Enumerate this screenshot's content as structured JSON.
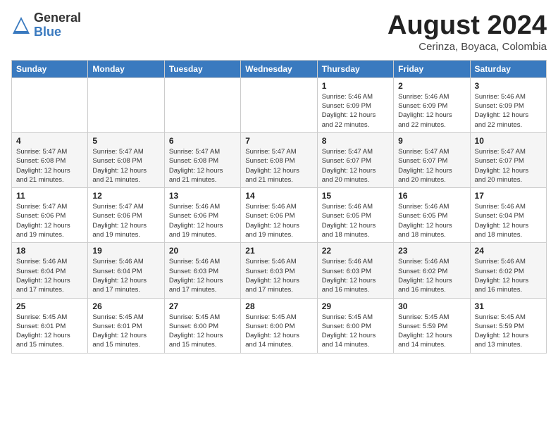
{
  "header": {
    "logo_general": "General",
    "logo_blue": "Blue",
    "month_title": "August 2024",
    "subtitle": "Cerinza, Boyaca, Colombia"
  },
  "weekdays": [
    "Sunday",
    "Monday",
    "Tuesday",
    "Wednesday",
    "Thursday",
    "Friday",
    "Saturday"
  ],
  "weeks": [
    [
      {
        "day": "",
        "content": ""
      },
      {
        "day": "",
        "content": ""
      },
      {
        "day": "",
        "content": ""
      },
      {
        "day": "",
        "content": ""
      },
      {
        "day": "1",
        "content": "Sunrise: 5:46 AM\nSunset: 6:09 PM\nDaylight: 12 hours\nand 22 minutes."
      },
      {
        "day": "2",
        "content": "Sunrise: 5:46 AM\nSunset: 6:09 PM\nDaylight: 12 hours\nand 22 minutes."
      },
      {
        "day": "3",
        "content": "Sunrise: 5:46 AM\nSunset: 6:09 PM\nDaylight: 12 hours\nand 22 minutes."
      }
    ],
    [
      {
        "day": "4",
        "content": "Sunrise: 5:47 AM\nSunset: 6:08 PM\nDaylight: 12 hours\nand 21 minutes."
      },
      {
        "day": "5",
        "content": "Sunrise: 5:47 AM\nSunset: 6:08 PM\nDaylight: 12 hours\nand 21 minutes."
      },
      {
        "day": "6",
        "content": "Sunrise: 5:47 AM\nSunset: 6:08 PM\nDaylight: 12 hours\nand 21 minutes."
      },
      {
        "day": "7",
        "content": "Sunrise: 5:47 AM\nSunset: 6:08 PM\nDaylight: 12 hours\nand 21 minutes."
      },
      {
        "day": "8",
        "content": "Sunrise: 5:47 AM\nSunset: 6:07 PM\nDaylight: 12 hours\nand 20 minutes."
      },
      {
        "day": "9",
        "content": "Sunrise: 5:47 AM\nSunset: 6:07 PM\nDaylight: 12 hours\nand 20 minutes."
      },
      {
        "day": "10",
        "content": "Sunrise: 5:47 AM\nSunset: 6:07 PM\nDaylight: 12 hours\nand 20 minutes."
      }
    ],
    [
      {
        "day": "11",
        "content": "Sunrise: 5:47 AM\nSunset: 6:06 PM\nDaylight: 12 hours\nand 19 minutes."
      },
      {
        "day": "12",
        "content": "Sunrise: 5:47 AM\nSunset: 6:06 PM\nDaylight: 12 hours\nand 19 minutes."
      },
      {
        "day": "13",
        "content": "Sunrise: 5:46 AM\nSunset: 6:06 PM\nDaylight: 12 hours\nand 19 minutes."
      },
      {
        "day": "14",
        "content": "Sunrise: 5:46 AM\nSunset: 6:06 PM\nDaylight: 12 hours\nand 19 minutes."
      },
      {
        "day": "15",
        "content": "Sunrise: 5:46 AM\nSunset: 6:05 PM\nDaylight: 12 hours\nand 18 minutes."
      },
      {
        "day": "16",
        "content": "Sunrise: 5:46 AM\nSunset: 6:05 PM\nDaylight: 12 hours\nand 18 minutes."
      },
      {
        "day": "17",
        "content": "Sunrise: 5:46 AM\nSunset: 6:04 PM\nDaylight: 12 hours\nand 18 minutes."
      }
    ],
    [
      {
        "day": "18",
        "content": "Sunrise: 5:46 AM\nSunset: 6:04 PM\nDaylight: 12 hours\nand 17 minutes."
      },
      {
        "day": "19",
        "content": "Sunrise: 5:46 AM\nSunset: 6:04 PM\nDaylight: 12 hours\nand 17 minutes."
      },
      {
        "day": "20",
        "content": "Sunrise: 5:46 AM\nSunset: 6:03 PM\nDaylight: 12 hours\nand 17 minutes."
      },
      {
        "day": "21",
        "content": "Sunrise: 5:46 AM\nSunset: 6:03 PM\nDaylight: 12 hours\nand 17 minutes."
      },
      {
        "day": "22",
        "content": "Sunrise: 5:46 AM\nSunset: 6:03 PM\nDaylight: 12 hours\nand 16 minutes."
      },
      {
        "day": "23",
        "content": "Sunrise: 5:46 AM\nSunset: 6:02 PM\nDaylight: 12 hours\nand 16 minutes."
      },
      {
        "day": "24",
        "content": "Sunrise: 5:46 AM\nSunset: 6:02 PM\nDaylight: 12 hours\nand 16 minutes."
      }
    ],
    [
      {
        "day": "25",
        "content": "Sunrise: 5:45 AM\nSunset: 6:01 PM\nDaylight: 12 hours\nand 15 minutes."
      },
      {
        "day": "26",
        "content": "Sunrise: 5:45 AM\nSunset: 6:01 PM\nDaylight: 12 hours\nand 15 minutes."
      },
      {
        "day": "27",
        "content": "Sunrise: 5:45 AM\nSunset: 6:00 PM\nDaylight: 12 hours\nand 15 minutes."
      },
      {
        "day": "28",
        "content": "Sunrise: 5:45 AM\nSunset: 6:00 PM\nDaylight: 12 hours\nand 14 minutes."
      },
      {
        "day": "29",
        "content": "Sunrise: 5:45 AM\nSunset: 6:00 PM\nDaylight: 12 hours\nand 14 minutes."
      },
      {
        "day": "30",
        "content": "Sunrise: 5:45 AM\nSunset: 5:59 PM\nDaylight: 12 hours\nand 14 minutes."
      },
      {
        "day": "31",
        "content": "Sunrise: 5:45 AM\nSunset: 5:59 PM\nDaylight: 12 hours\nand 13 minutes."
      }
    ]
  ]
}
